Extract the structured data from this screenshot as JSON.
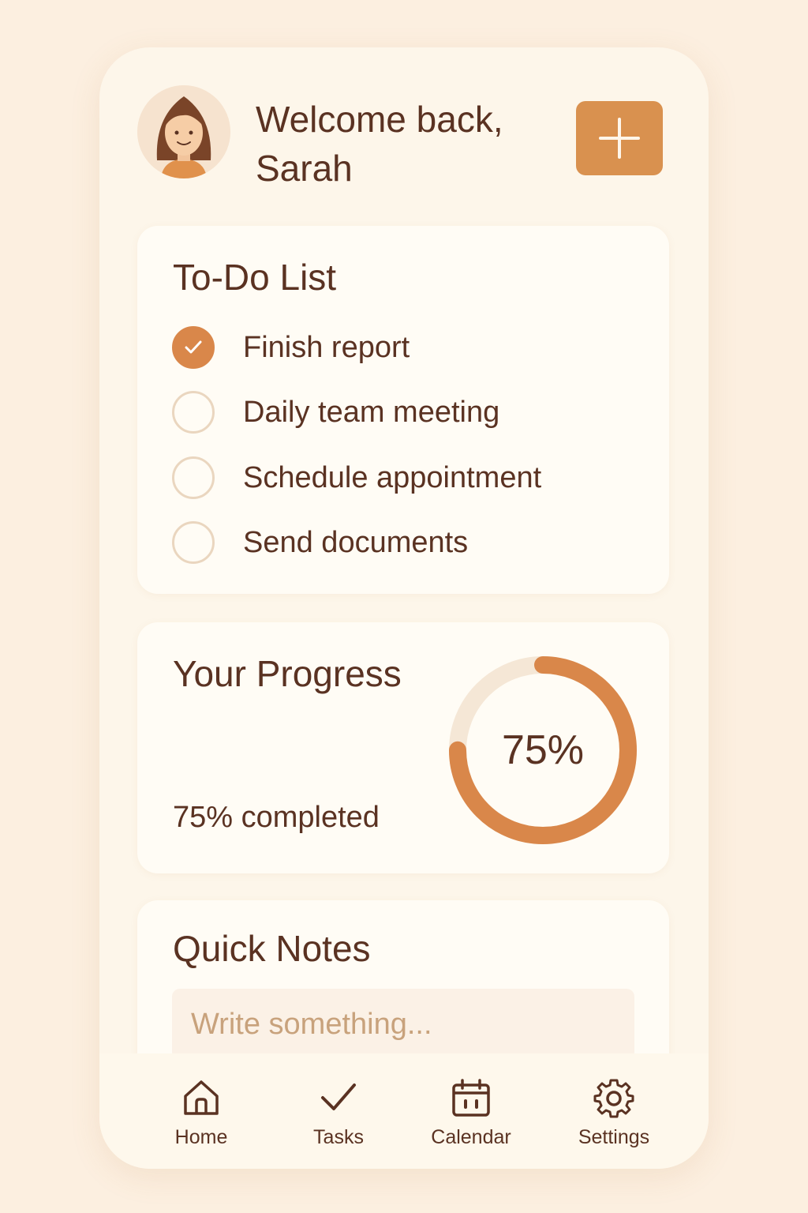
{
  "header": {
    "greeting_line1": "Welcome back,",
    "greeting_line2": "Sarah",
    "add_button_icon": "plus-icon"
  },
  "todo": {
    "title": "To-Do List",
    "items": [
      {
        "label": "Finish report",
        "done": true
      },
      {
        "label": "Daily team meeting",
        "done": false
      },
      {
        "label": "Schedule appointment",
        "done": false
      },
      {
        "label": "Send documents",
        "done": false
      }
    ]
  },
  "progress": {
    "title": "Your Progress",
    "percent": 75,
    "percent_label": "75%",
    "subtitle": "75% completed"
  },
  "notes": {
    "title": "Quick Notes",
    "placeholder": "Write something..."
  },
  "nav": {
    "items": [
      {
        "label": "Home",
        "icon": "home-icon"
      },
      {
        "label": "Tasks",
        "icon": "check-icon"
      },
      {
        "label": "Calendar",
        "icon": "calendar-icon"
      },
      {
        "label": "Settings",
        "icon": "gear-icon"
      }
    ]
  },
  "colors": {
    "background": "#fcefe0",
    "card": "#fffcf5",
    "accent": "#d9874a",
    "text": "#5a3222",
    "ring_track": "#f5e7d6"
  }
}
